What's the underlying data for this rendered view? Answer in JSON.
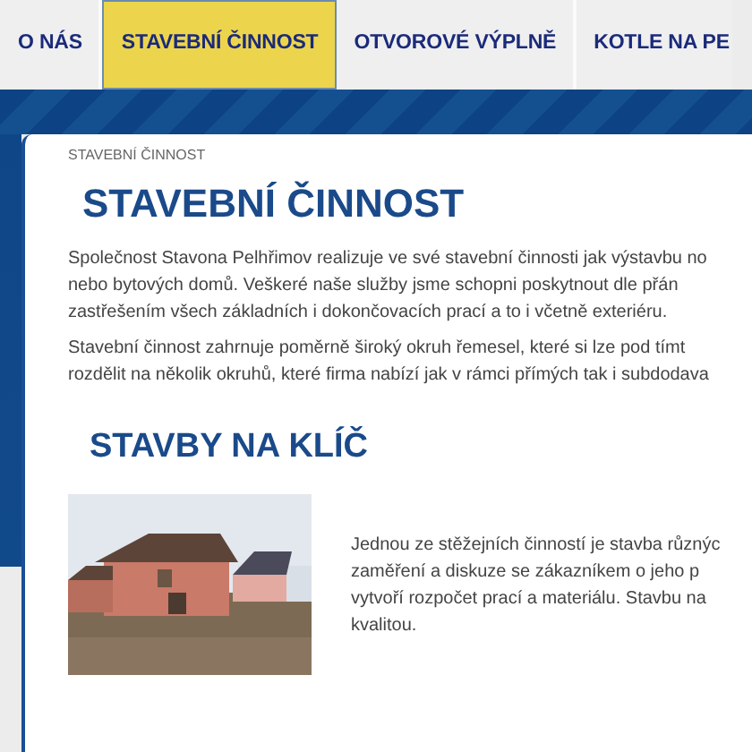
{
  "nav": [
    {
      "label": "O NÁS",
      "selected": false
    },
    {
      "label": "STAVEBNÍ ČINNOST",
      "selected": true
    },
    {
      "label": "OTVOROVÉ VÝPLNĚ",
      "selected": false
    },
    {
      "label": "KOTLE NA PE",
      "selected": false
    }
  ],
  "breadcrumb": "STAVEBNÍ ČINNOST",
  "title": "STAVEBNÍ ČINNOST",
  "paragraphs": [
    [
      "Společnost Stavona Pelhřimov realizuje ve své stavební činnosti jak výstavbu no",
      "nebo bytových domů. Veškeré naše služby jsme schopni poskytnout dle přán",
      "zastřešením všech základních i dokončovacích prací a to i včetně exteriéru."
    ],
    [
      "Stavební činnost zahrnuje poměrně široký okruh řemesel, které si lze pod tímt",
      "rozdělit na několik okruhů, které firma nabízí jak v rámci přímých tak i subdodava"
    ]
  ],
  "section": {
    "title": "STAVBY NA KLÍČ",
    "lines": [
      "Jednou ze stěžejních činností je stavba různýc",
      "zaměření a diskuze se zákazníkem o jeho p",
      "vytvoří rozpočet prací a materiálu. Stavbu na",
      "kvalitou."
    ]
  }
}
